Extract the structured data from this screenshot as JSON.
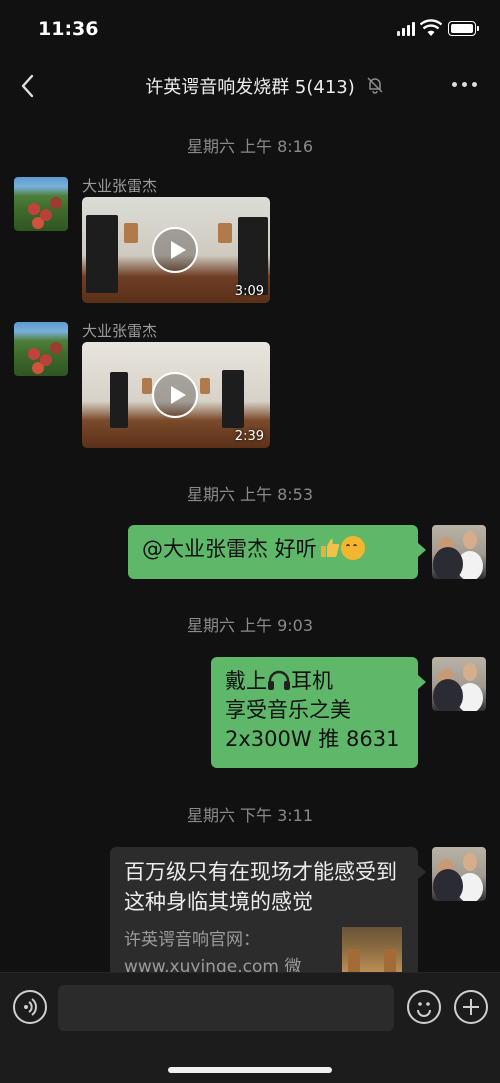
{
  "status_bar": {
    "time": "11:36"
  },
  "header": {
    "title": "许英谔音响发烧群 5(413)"
  },
  "messages": [
    {
      "kind": "time",
      "text": "星期六 上午 8:16"
    },
    {
      "kind": "video",
      "sender": "大业张雷杰",
      "duration": "3:09"
    },
    {
      "kind": "video",
      "sender": "大业张雷杰",
      "duration": "2:39"
    },
    {
      "kind": "time",
      "text": "星期六 上午 8:53"
    },
    {
      "kind": "text",
      "side": "right",
      "text": "@大业张雷杰 好听"
    },
    {
      "kind": "time",
      "text": "星期六 上午 9:03"
    },
    {
      "kind": "text",
      "side": "right",
      "line1_a": "戴上",
      "line1_b": "耳机",
      "line2": "享受音乐之美",
      "line3": "2x300W 推 8631"
    },
    {
      "kind": "time",
      "text": "星期六 下午 3:11"
    },
    {
      "kind": "link",
      "side": "right",
      "title": "百万级只有在现场才能感受到这种身临其境的感觉",
      "desc_line1": "许英谔音响官网：",
      "desc_line2": "www.xuyinge.com  微"
    }
  ],
  "colors": {
    "bubble_green": "#5fb86a",
    "background": "#111111",
    "bubble_dark": "#2c2c2c"
  }
}
